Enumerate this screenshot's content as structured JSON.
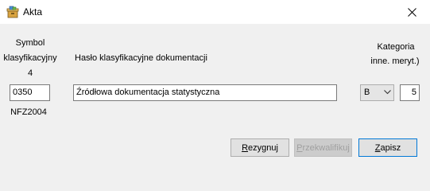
{
  "window": {
    "title": "Akta",
    "close_label": "✕"
  },
  "symbol": {
    "label_line1": "Symbol",
    "label_line2": "klasyfikacyjny",
    "level": "4",
    "value": "0350",
    "catalog": "NFZ2004"
  },
  "haslo": {
    "label": "Hasło klasyfikacyjne dokumentacji",
    "value": "Źródłowa dokumentacja statystyczna"
  },
  "kategoria": {
    "label_line1": "Kategoria",
    "label_line2": "inne. meryt.)",
    "select_value": "B",
    "years": "5"
  },
  "buttons": {
    "rezygnuj": {
      "first": "R",
      "rest": "ezygnuj"
    },
    "przekwalifikuj": {
      "first": "P",
      "rest": "rzekwalifikuj"
    },
    "zapisz": {
      "first": "Z",
      "rest": "apisz"
    }
  },
  "colors": {
    "accent": "#0078d7",
    "background": "#f0f0f0"
  }
}
